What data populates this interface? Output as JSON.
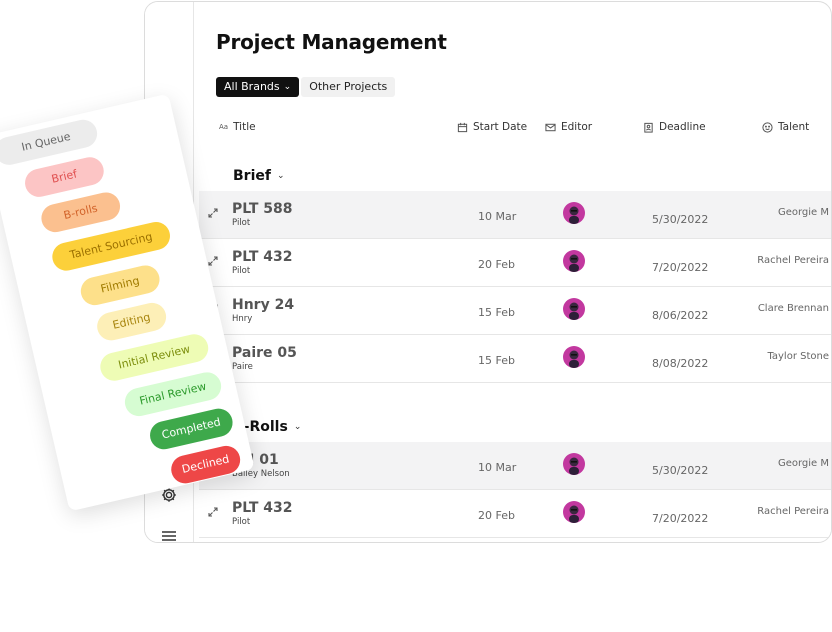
{
  "page": {
    "title": "Project Management"
  },
  "filters": [
    {
      "label": "All Brands",
      "caret": "⌄",
      "active": true
    },
    {
      "label": "Other Projects",
      "active": false
    }
  ],
  "columns": {
    "title_prefix": "Aa",
    "title": "Title",
    "start_date": "Start Date",
    "editor": "Editor",
    "deadline": "Deadline",
    "talent": "Talent"
  },
  "groups": [
    {
      "name": "Brief",
      "rows": [
        {
          "title": "PLT 588",
          "sub": "Pilot",
          "start": "10 Mar",
          "deadline": "5/30/2022",
          "talent": "Georgie M"
        },
        {
          "title": "PLT 432",
          "sub": "Pilot",
          "start": "20 Feb",
          "deadline": "7/20/2022",
          "talent": "Rachel Pereira"
        },
        {
          "title": "Hnry 24",
          "sub": "Hnry",
          "start": "15 Feb",
          "deadline": "8/06/2022",
          "talent": "Clare Brennan"
        },
        {
          "title": "Paire 05",
          "sub": "Paire",
          "start": "15 Feb",
          "deadline": "8/08/2022",
          "talent": "Taylor Stone"
        }
      ]
    },
    {
      "name": "B-Rolls",
      "rows": [
        {
          "title": "BN 01",
          "sub": "Bailey Nelson",
          "start": "10 Mar",
          "deadline": "5/30/2022",
          "talent": "Georgie M"
        },
        {
          "title": "PLT 432",
          "sub": "Pilot",
          "start": "20 Feb",
          "deadline": "7/20/2022",
          "talent": "Rachel Pereira"
        }
      ]
    }
  ],
  "statuses": [
    {
      "label": "In Queue",
      "bg": "#ececec",
      "fg": "#666666"
    },
    {
      "label": "Brief",
      "bg": "#fcc5c5",
      "fg": "#e05050"
    },
    {
      "label": "B-rolls",
      "bg": "#fbc08f",
      "fg": "#d2632a"
    },
    {
      "label": "Talent Sourcing",
      "bg": "#fcd03a",
      "fg": "#9b7000"
    },
    {
      "label": "Filming",
      "bg": "#fde08a",
      "fg": "#a07b00"
    },
    {
      "label": "Editing",
      "bg": "#fdefb7",
      "fg": "#a8850e"
    },
    {
      "label": "Initial Review",
      "bg": "#eefcb5",
      "fg": "#7d8f0d"
    },
    {
      "label": "Final Review",
      "bg": "#d6fcd2",
      "fg": "#2b9a2b"
    },
    {
      "label": "Completed",
      "bg": "#3ea94b",
      "fg": "#ffffff"
    },
    {
      "label": "Declined",
      "bg": "#ee4747",
      "fg": "#ffffff"
    }
  ],
  "colors": {
    "avatar": "#c2389f",
    "primary_text": "#111111"
  }
}
